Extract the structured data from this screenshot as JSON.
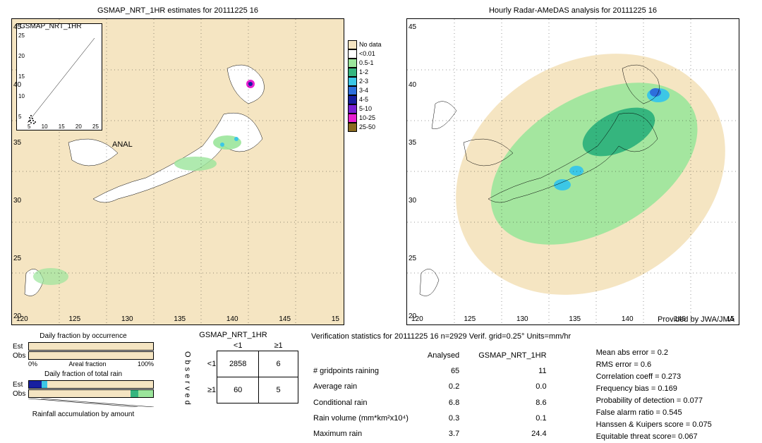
{
  "left_map": {
    "title": "GSMAP_NRT_1HR estimates for 20111225 16",
    "inset_title": "GSMAP_NRT_1HR",
    "anal_label": "ANAL"
  },
  "right_map": {
    "title": "Hourly Radar-AMeDAS analysis for 20111225 16",
    "credit": "Provided by JWA/JMA"
  },
  "x_ticks": [
    "120",
    "125",
    "130",
    "135",
    "140",
    "145",
    "15"
  ],
  "y_ticks": [
    "20",
    "25",
    "30",
    "35",
    "40",
    "45"
  ],
  "inset_x": [
    "5",
    "10",
    "15",
    "20",
    "25"
  ],
  "inset_y": [
    "5",
    "10",
    "15",
    "20",
    "25"
  ],
  "legend": [
    {
      "label": "No data",
      "color": "#f5e5c2"
    },
    {
      "label": "<0.01",
      "color": "#ffffff"
    },
    {
      "label": "0.5-1",
      "color": "#9be59b"
    },
    {
      "label": "1-2",
      "color": "#35b57e"
    },
    {
      "label": "2-3",
      "color": "#3cc7e6"
    },
    {
      "label": "3-4",
      "color": "#2d6fdc"
    },
    {
      "label": "4-5",
      "color": "#171fa0"
    },
    {
      "label": "5-10",
      "color": "#7a20d5"
    },
    {
      "label": "10-25",
      "color": "#e81fd1"
    },
    {
      "label": "25-50",
      "color": "#8a6a1f"
    }
  ],
  "bars": {
    "h1": "Daily fraction by occurrence",
    "h2": "Daily fraction of total rain",
    "h3": "Rainfall accumulation by amount",
    "scale_lo": "0%",
    "scale_mid": "Areal fraction",
    "scale_hi": "100%",
    "row_est": "Est",
    "row_obs": "Obs"
  },
  "contingency": {
    "title": "GSMAP_NRT_1HR",
    "col1": "<1",
    "col2": "≥1",
    "row1": "<1",
    "row2": "≥1",
    "a": "2858",
    "b": "6",
    "c": "60",
    "d": "5",
    "obs": "Observed"
  },
  "stats": {
    "title": "Verification statistics for 20111225 16  n=2929  Verif. grid=0.25°  Units=mm/hr",
    "head_anal": "Analysed",
    "head_est": "GSMAP_NRT_1HR",
    "rows": [
      {
        "label": "# gridpoints raining",
        "a": "65",
        "b": "11"
      },
      {
        "label": "Average rain",
        "a": "0.2",
        "b": "0.0"
      },
      {
        "label": "Conditional rain",
        "a": "6.8",
        "b": "8.6"
      },
      {
        "label": "Rain volume (mm*km²x10⁴)",
        "a": "0.3",
        "b": "0.1"
      },
      {
        "label": "Maximum rain",
        "a": "3.7",
        "b": "24.4"
      }
    ],
    "metrics": [
      "Mean abs error = 0.2",
      "RMS error = 0.6",
      "Correlation coeff = 0.273",
      "Frequency bias = 0.169",
      "Probability of detection = 0.077",
      "False alarm ratio = 0.545",
      "Hanssen & Kuipers score = 0.075",
      "Equitable threat score= 0.067"
    ]
  },
  "chart_data": {
    "type": "table",
    "title": "Verification statistics for 20111225 16",
    "n": 2929,
    "grid_deg": 0.25,
    "units": "mm/hr",
    "contingency": {
      "obs_lt1_est_lt1": 2858,
      "obs_lt1_est_ge1": 6,
      "obs_ge1_est_lt1": 60,
      "obs_ge1_est_ge1": 5
    },
    "variables": [
      "# gridpoints raining",
      "Average rain",
      "Conditional rain",
      "Rain volume (mm*km2*1e4)",
      "Maximum rain"
    ],
    "analysed": [
      65,
      0.2,
      6.8,
      0.3,
      3.7
    ],
    "gsmap_nrt_1hr": [
      11,
      0.0,
      8.6,
      0.1,
      24.4
    ],
    "scores": {
      "mean_abs_error": 0.2,
      "rms_error": 0.6,
      "correlation": 0.273,
      "frequency_bias": 0.169,
      "pod": 0.077,
      "far": 0.545,
      "hk": 0.075,
      "ets": 0.067
    },
    "precipitation_legend_mm_per_hr": [
      "No data",
      "<0.01",
      "0.5-1",
      "1-2",
      "2-3",
      "3-4",
      "4-5",
      "5-10",
      "10-25",
      "25-50"
    ],
    "map_extent": {
      "lon": [
        118,
        152
      ],
      "lat": [
        20,
        48
      ]
    }
  }
}
